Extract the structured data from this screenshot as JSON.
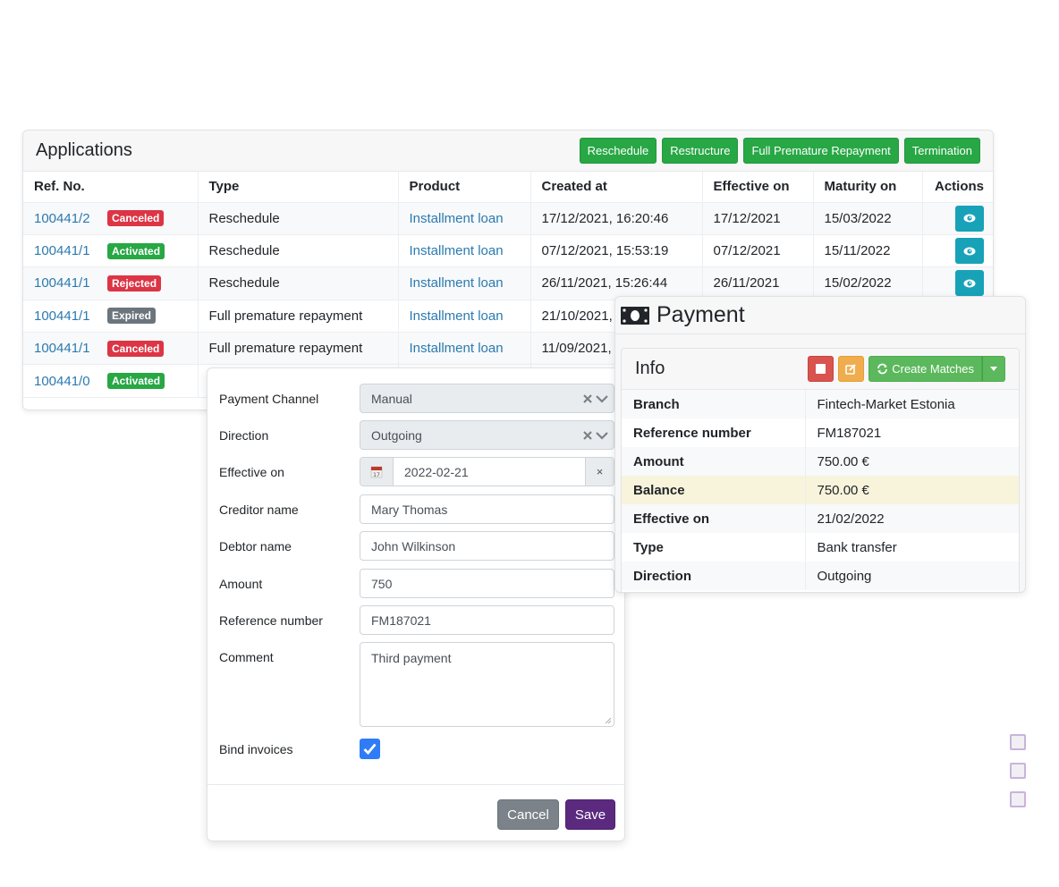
{
  "applications": {
    "title": "Applications",
    "actions": [
      "Reschedule",
      "Restructure",
      "Full Premature Repayment",
      "Termination"
    ],
    "columns": [
      "Ref. No.",
      "Type",
      "Product",
      "Created at",
      "Effective on",
      "Maturity on",
      "Actions"
    ],
    "rows": [
      {
        "ref": "100441/2",
        "status": "Canceled",
        "status_color": "red",
        "type": "Reschedule",
        "product": "Installment loan",
        "created": "17/12/2021, 16:20:46",
        "effective": "17/12/2021",
        "maturity": "15/03/2022"
      },
      {
        "ref": "100441/1",
        "status": "Activated",
        "status_color": "green",
        "type": "Reschedule",
        "product": "Installment loan",
        "created": "07/12/2021, 15:53:19",
        "effective": "07/12/2021",
        "maturity": "15/11/2022"
      },
      {
        "ref": "100441/1",
        "status": "Rejected",
        "status_color": "red",
        "type": "Reschedule",
        "product": "Installment loan",
        "created": "26/11/2021, 15:26:44",
        "effective": "26/11/2021",
        "maturity": "15/02/2022"
      },
      {
        "ref": "100441/1",
        "status": "Expired",
        "status_color": "gray",
        "type": "Full premature repayment",
        "product": "Installment loan",
        "created": "21/10/2021,",
        "effective": "",
        "maturity": ""
      },
      {
        "ref": "100441/1",
        "status": "Canceled",
        "status_color": "red",
        "type": "Full premature repayment",
        "product": "Installment loan",
        "created": "11/09/2021,",
        "effective": "",
        "maturity": ""
      },
      {
        "ref": "100441/0",
        "status": "Activated",
        "status_color": "green",
        "type": "",
        "product": "",
        "created": "",
        "effective": "",
        "maturity": ""
      }
    ],
    "view_icon": "eye-icon"
  },
  "payment": {
    "title": "Payment",
    "icon": "money-bill-icon",
    "info": {
      "title": "Info",
      "buttons": {
        "stop_icon": "stop-icon",
        "edit_icon": "edit-icon",
        "create_matches": "Create Matches",
        "refresh_icon": "refresh-icon"
      },
      "rows": [
        {
          "label": "Branch",
          "value": "Fintech-Market Estonia"
        },
        {
          "label": "Reference number",
          "value": "FM187021"
        },
        {
          "label": "Amount",
          "value": "750.00 €"
        },
        {
          "label": "Balance",
          "value": "750.00 €"
        },
        {
          "label": "Effective on",
          "value": "21/02/2022"
        },
        {
          "label": "Type",
          "value": "Bank transfer"
        },
        {
          "label": "Direction",
          "value": "Outgoing"
        }
      ]
    }
  },
  "form": {
    "payment_channel": {
      "label": "Payment Channel",
      "value": "Manual"
    },
    "direction": {
      "label": "Direction",
      "value": "Outgoing"
    },
    "effective_on": {
      "label": "Effective on",
      "value": "2022-02-21",
      "calendar_day": "17"
    },
    "creditor_name": {
      "label": "Creditor name",
      "value": "Mary Thomas"
    },
    "debtor_name": {
      "label": "Debtor name",
      "value": "John Wilkinson"
    },
    "amount": {
      "label": "Amount",
      "value": "750"
    },
    "reference_number": {
      "label": "Reference number",
      "value": "FM187021"
    },
    "comment": {
      "label": "Comment",
      "value": "Third payment"
    },
    "bind_invoices": {
      "label": "Bind invoices",
      "checked": true
    },
    "cancel_label": "Cancel",
    "save_label": "Save",
    "clear_glyph": "×"
  },
  "colors": {
    "link": "#2a7ab0",
    "success": "#28a745",
    "danger": "#dc3545",
    "secondary": "#6c757d",
    "info": "#17a2b8",
    "save": "#5b2a7f",
    "highlight_row": "#f8f4dc"
  }
}
